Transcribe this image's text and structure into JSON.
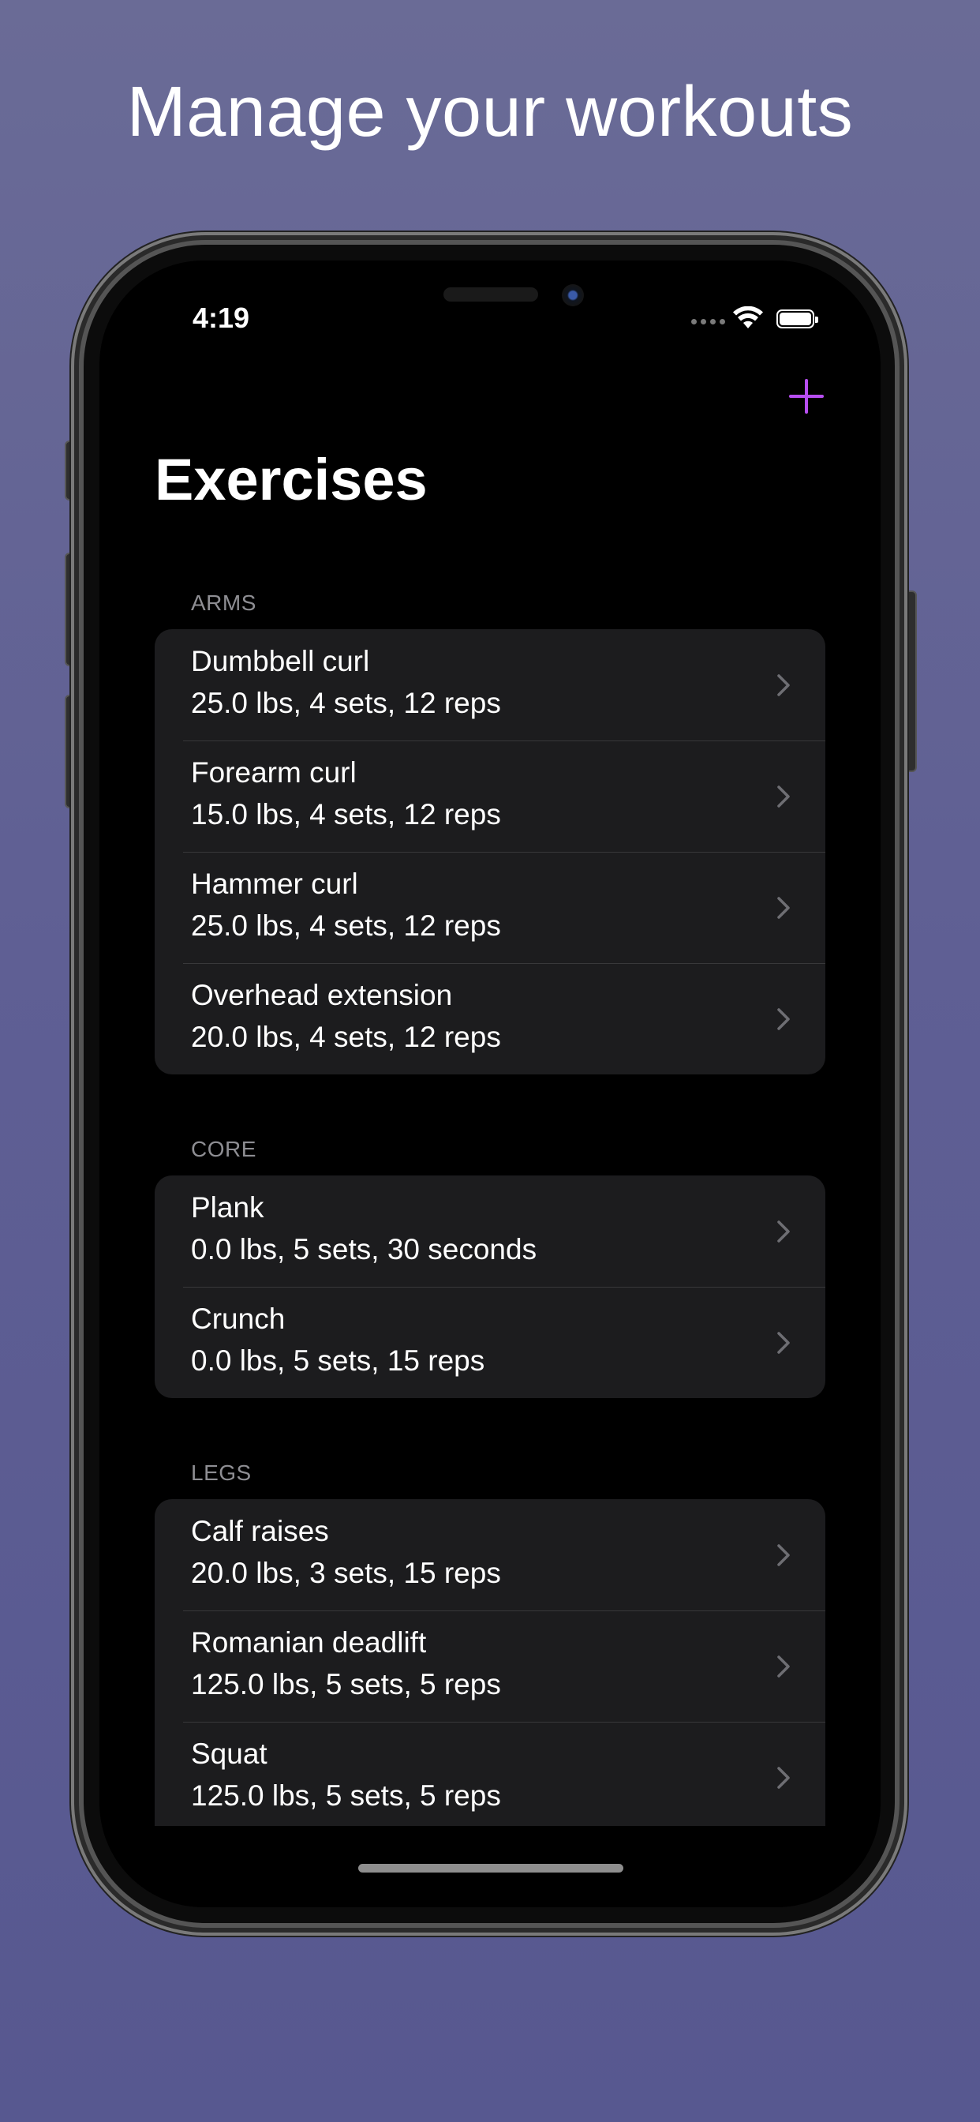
{
  "headline": "Manage your workouts",
  "status_bar": {
    "time": "4:19"
  },
  "nav": {
    "add_icon": "plus-icon",
    "title": "Exercises"
  },
  "colors": {
    "accent": "#b74ef0",
    "background": "#5f5f94",
    "cell": "#1c1c1e"
  },
  "sections": [
    {
      "header": "ARMS",
      "items": [
        {
          "name": "Dumbbell curl",
          "detail": "25.0 lbs, 4 sets, 12 reps"
        },
        {
          "name": "Forearm curl",
          "detail": "15.0 lbs, 4 sets, 12 reps"
        },
        {
          "name": "Hammer curl",
          "detail": "25.0 lbs, 4 sets, 12 reps"
        },
        {
          "name": "Overhead extension",
          "detail": "20.0 lbs, 4 sets, 12 reps"
        }
      ]
    },
    {
      "header": "CORE",
      "items": [
        {
          "name": "Plank",
          "detail": "0.0 lbs, 5 sets, 30 seconds"
        },
        {
          "name": "Crunch",
          "detail": "0.0 lbs, 5 sets, 15 reps"
        }
      ]
    },
    {
      "header": "LEGS",
      "items": [
        {
          "name": "Calf raises",
          "detail": "20.0 lbs, 3 sets, 15 reps"
        },
        {
          "name": "Romanian deadlift",
          "detail": "125.0 lbs, 5 sets, 5 reps"
        },
        {
          "name": "Squat",
          "detail": "125.0 lbs, 5 sets, 5 reps"
        }
      ]
    }
  ]
}
